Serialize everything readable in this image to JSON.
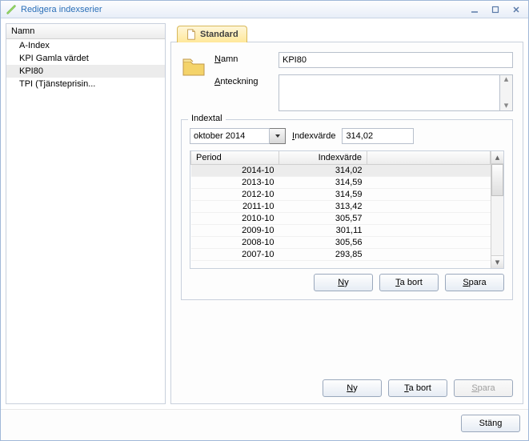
{
  "window": {
    "title": "Redigera indexserier"
  },
  "sidebar": {
    "header": "Namn",
    "items": [
      {
        "label": "A-Index"
      },
      {
        "label": "KPI Gamla värdet"
      },
      {
        "label": "KPI80",
        "selected": true
      },
      {
        "label": "TPI (Tjänsteprisin..."
      }
    ]
  },
  "tab": {
    "label": "Standard"
  },
  "form": {
    "name_label": "Namn",
    "name_value": "KPI80",
    "note_label": "Anteckning",
    "note_value": ""
  },
  "fieldset": {
    "legend": "Indextal",
    "period_value": "oktober 2014",
    "indexvalue_label": "Indexvärde",
    "indexvalue_value": "314,02",
    "columns": {
      "period": "Period",
      "value": "Indexvärde"
    },
    "rows": [
      {
        "period": "2014-10",
        "value": "314,02",
        "selected": true
      },
      {
        "period": "2013-10",
        "value": "314,59"
      },
      {
        "period": "2012-10",
        "value": "314,59"
      },
      {
        "period": "2011-10",
        "value": "313,42"
      },
      {
        "period": "2010-10",
        "value": "305,57"
      },
      {
        "period": "2009-10",
        "value": "301,11"
      },
      {
        "period": "2008-10",
        "value": "305,56"
      },
      {
        "period": "2007-10",
        "value": "293,85"
      }
    ],
    "buttons": {
      "new": "Ny",
      "delete": "Ta bort",
      "save": "Spara"
    }
  },
  "main_buttons": {
    "new": "Ny",
    "delete": "Ta bort",
    "save": "Spara"
  },
  "footer": {
    "close": "Stäng"
  }
}
